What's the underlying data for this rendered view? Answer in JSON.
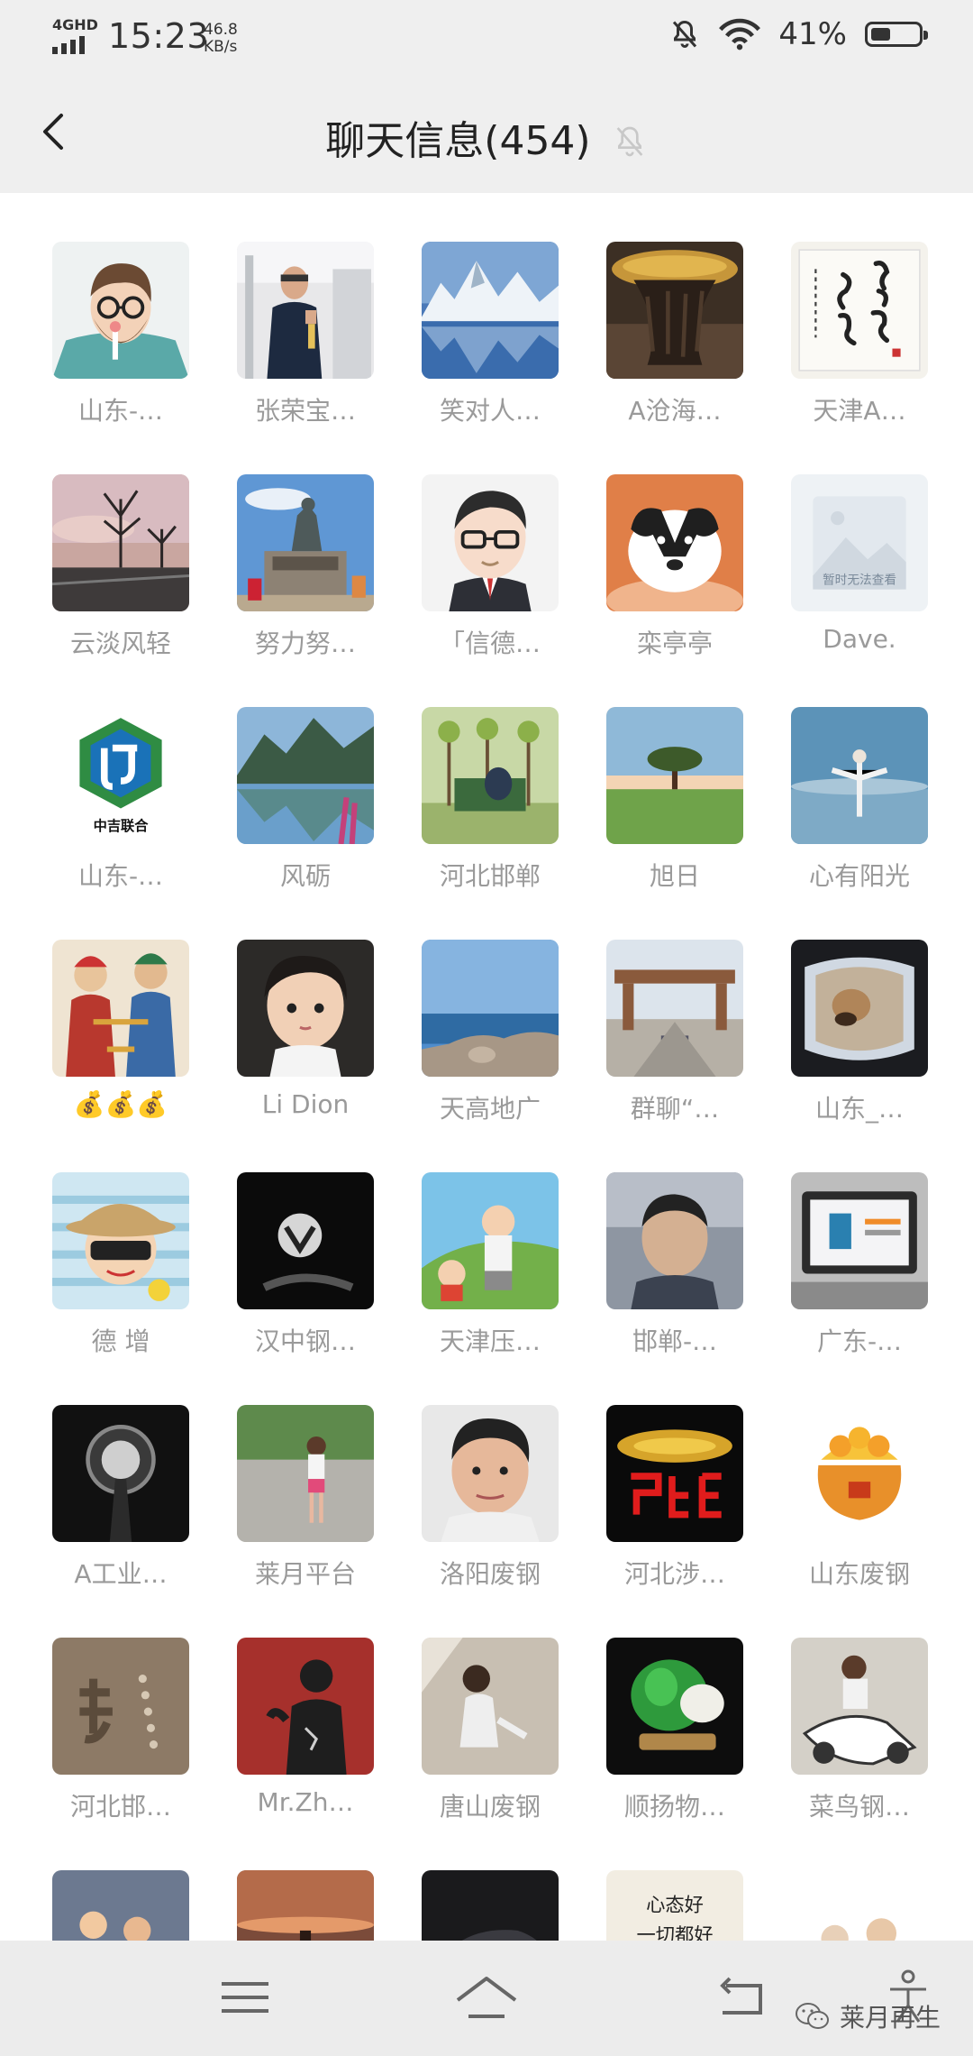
{
  "status_bar": {
    "network": "4GHD",
    "time": "15:23",
    "net_speed_value": "46.8",
    "net_speed_unit": "KB/s",
    "battery": "41%",
    "battery_level": 0.41
  },
  "header": {
    "title": "聊天信息(454)"
  },
  "members": [
    {
      "name": "山东-…"
    },
    {
      "name": "张荣宝…"
    },
    {
      "name": "笑对人…"
    },
    {
      "name": "A沧海…"
    },
    {
      "name": "天津A…"
    },
    {
      "name": "云淡风轻"
    },
    {
      "name": "努力努…"
    },
    {
      "name": "「信德…"
    },
    {
      "name": "栾亭亭"
    },
    {
      "name": "Dave."
    },
    {
      "name": "山东-…"
    },
    {
      "name": "风砺"
    },
    {
      "name": "河北邯郸"
    },
    {
      "name": "旭日"
    },
    {
      "name": "心有阳光"
    },
    {
      "name": "💰💰💰"
    },
    {
      "name": "Li Dion"
    },
    {
      "name": "天高地广"
    },
    {
      "name": "群聊“…"
    },
    {
      "name": "山东_…"
    },
    {
      "name": "德 增"
    },
    {
      "name": "汉中钢…"
    },
    {
      "name": "天津压…"
    },
    {
      "name": "邯郸-…"
    },
    {
      "name": "广东-…"
    },
    {
      "name": "A工业…"
    },
    {
      "name": "莱月平台"
    },
    {
      "name": "洛阳废钢"
    },
    {
      "name": "河北涉…"
    },
    {
      "name": "山东废钢"
    },
    {
      "name": "河北邯…"
    },
    {
      "name": "Mr.Zh…"
    },
    {
      "name": "唐山废钢"
    },
    {
      "name": "顺扬物…"
    },
    {
      "name": "菜鸟钢…"
    }
  ],
  "dave_avatar_text": "暂时无法查看",
  "avatar_texts": {
    "zhongji_logo": "中吉联合",
    "calligraphy": "笑对人生",
    "dragon_char": "龍",
    "partial_row_banner": "心态好 一切都好"
  },
  "watermark": "莱月再生"
}
